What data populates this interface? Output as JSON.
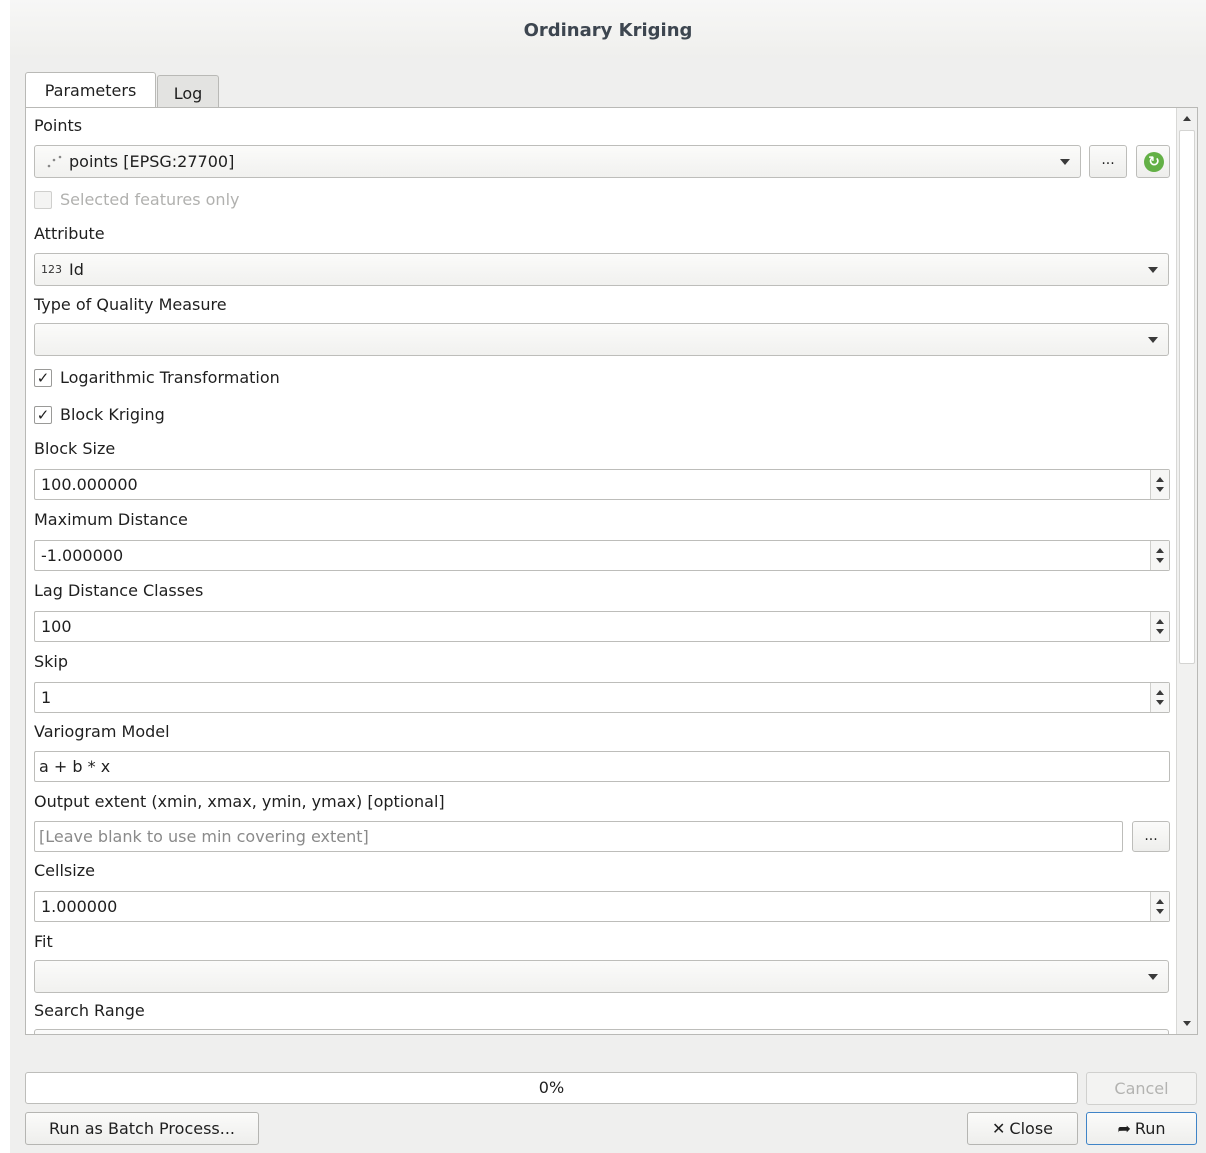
{
  "window": {
    "title": "Ordinary Kriging"
  },
  "tabs": [
    {
      "label": "Parameters"
    },
    {
      "label": "Log"
    }
  ],
  "params": {
    "points": {
      "label": "Points",
      "value": "points [EPSG:27700]",
      "browse_label": "..."
    },
    "selected_only": {
      "label": "Selected features only",
      "checked": false,
      "enabled": false
    },
    "attribute": {
      "label": "Attribute",
      "type_badge": "123",
      "value": "Id"
    },
    "quality_measure": {
      "label": "Type of Quality Measure",
      "value": ""
    },
    "log_transform": {
      "label": "Logarithmic Transformation",
      "checked": true,
      "mark": "✓"
    },
    "block_kriging": {
      "label": "Block Kriging",
      "checked": true,
      "mark": "✓"
    },
    "block_size": {
      "label": "Block Size",
      "value": "100.000000"
    },
    "max_distance": {
      "label": "Maximum Distance",
      "value": "-1.000000"
    },
    "lag_classes": {
      "label": "Lag Distance Classes",
      "value": "100"
    },
    "skip": {
      "label": "Skip",
      "value": "1"
    },
    "variogram": {
      "label": "Variogram Model",
      "value": "a + b * x"
    },
    "output_extent": {
      "label": "Output extent (xmin, xmax, ymin, ymax) [optional]",
      "placeholder": "[Leave blank to use min covering extent]",
      "browse_label": "..."
    },
    "cellsize": {
      "label": "Cellsize",
      "value": "1.000000"
    },
    "fit": {
      "label": "Fit",
      "value": ""
    },
    "search_range": {
      "label": "Search Range"
    }
  },
  "footer": {
    "progress_text": "0%",
    "progress": 0,
    "cancel_label": "Cancel",
    "batch_label": "Run as Batch Process...",
    "close_label": "Close",
    "run_label": "Run"
  },
  "colors": {
    "refresh_green": "#63b046",
    "run_border": "#3f84c7"
  }
}
